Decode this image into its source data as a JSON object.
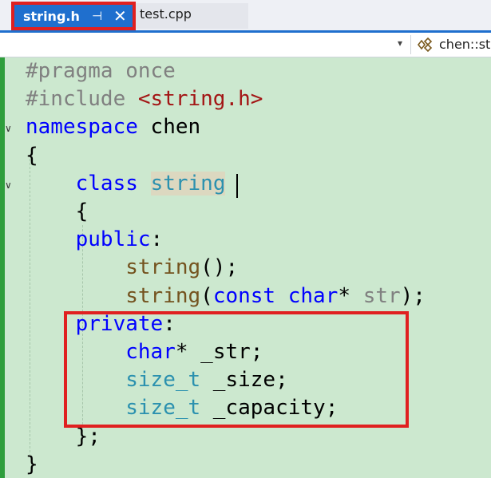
{
  "tabs": [
    {
      "label": "string.h",
      "active": true
    },
    {
      "label": "test.cpp",
      "active": false
    }
  ],
  "navbar": {
    "member": "chen::st"
  },
  "code": {
    "lines": [
      [
        {
          "t": "#pragma once",
          "c": "pre"
        }
      ],
      [
        {
          "t": "#include ",
          "c": "pre"
        },
        {
          "t": "<string.h>",
          "c": "str"
        }
      ],
      [
        {
          "t": "namespace",
          "c": "kw"
        },
        {
          "t": " chen",
          "c": ""
        }
      ],
      [
        {
          "t": "{",
          "c": ""
        }
      ],
      [
        {
          "t": "    ",
          "c": ""
        },
        {
          "t": "class",
          "c": "kw"
        },
        {
          "t": " ",
          "c": ""
        },
        {
          "t": "string",
          "c": "type hl"
        }
      ],
      [
        {
          "t": "    {",
          "c": ""
        }
      ],
      [
        {
          "t": "    ",
          "c": ""
        },
        {
          "t": "public",
          "c": "kw"
        },
        {
          "t": ":",
          "c": ""
        }
      ],
      [
        {
          "t": "        ",
          "c": ""
        },
        {
          "t": "string",
          "c": "fn"
        },
        {
          "t": "();",
          "c": ""
        }
      ],
      [
        {
          "t": "        ",
          "c": ""
        },
        {
          "t": "string",
          "c": "fn"
        },
        {
          "t": "(",
          "c": ""
        },
        {
          "t": "const",
          "c": "kw"
        },
        {
          "t": " ",
          "c": ""
        },
        {
          "t": "char",
          "c": "kw"
        },
        {
          "t": "* ",
          "c": ""
        },
        {
          "t": "str",
          "c": "param"
        },
        {
          "t": ");",
          "c": ""
        }
      ],
      [
        {
          "t": "    ",
          "c": ""
        },
        {
          "t": "private",
          "c": "kw"
        },
        {
          "t": ":",
          "c": ""
        }
      ],
      [
        {
          "t": "        ",
          "c": ""
        },
        {
          "t": "char",
          "c": "kw"
        },
        {
          "t": "* _str;",
          "c": ""
        }
      ],
      [
        {
          "t": "        ",
          "c": ""
        },
        {
          "t": "size_t",
          "c": "type"
        },
        {
          "t": " _size;",
          "c": ""
        }
      ],
      [
        {
          "t": "        ",
          "c": ""
        },
        {
          "t": "size_t",
          "c": "type"
        },
        {
          "t": " _capacity;",
          "c": ""
        }
      ],
      [
        {
          "t": "    };",
          "c": ""
        }
      ],
      [
        {
          "t": "}",
          "c": ""
        }
      ]
    ]
  },
  "colors": {
    "editor_bg": "#cce8cf",
    "keyword": "#0000ff",
    "type": "#2b91af",
    "function": "#74531f",
    "preprocessor": "#808080",
    "string": "#a31515",
    "highlight_border": "#e02020",
    "tab_active": "#1f6fce"
  }
}
